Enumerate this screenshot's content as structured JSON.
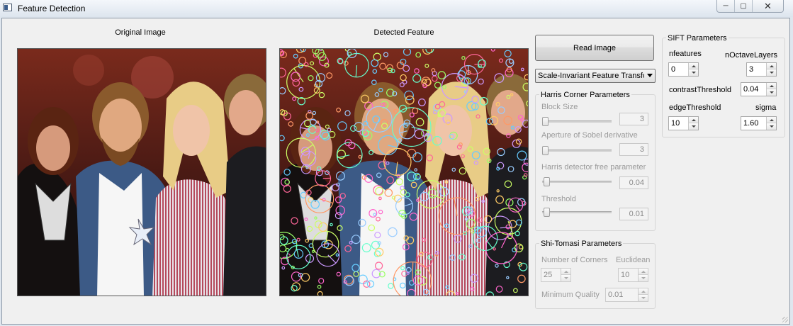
{
  "window": {
    "title": "Feature Detection",
    "minimize_glyph": "─",
    "restore_glyph": "▢",
    "close_glyph": "✕"
  },
  "captions": {
    "original": "Original Image",
    "detected": "Detected Feature"
  },
  "read_button": "Read Image",
  "method_combo": "Scale-Invariant Feature Transform",
  "harris": {
    "title": "Harris Corner Parameters",
    "block_size_label": "Block Size",
    "block_size_value": "3",
    "aperture_label": "Aperture  of  Sobel derivative",
    "aperture_value": "3",
    "free_param_label": "Harris detector free parameter",
    "free_param_value": "0.04",
    "threshold_label": "Threshold",
    "threshold_value": "0.01"
  },
  "shi_tomasi": {
    "title": "Shi-Tomasi Parameters",
    "corners_label": "Number of Corners",
    "corners_value": "25",
    "euclidean_label": "Euclidean",
    "euclidean_value": "10",
    "quality_label": "Minimum Quality",
    "quality_value": "0.01"
  },
  "sift": {
    "title": "SIFT Parameters",
    "nfeatures_label": "nfeatures",
    "nfeatures_value": "0",
    "noctave_label": "nOctaveLayers",
    "noctave_value": "3",
    "contrast_label": "contrastThreshold",
    "contrast_value": "0.04",
    "edge_label": "edgeThreshold",
    "edge_value": "10",
    "sigma_label": "sigma",
    "sigma_value": "1.60"
  },
  "icons": [
    "app-icon",
    "minimize-icon",
    "restore-icon",
    "close-icon",
    "spin-up-icon",
    "spin-down-icon",
    "dropdown-arrow-icon",
    "resize-grip-icon"
  ]
}
